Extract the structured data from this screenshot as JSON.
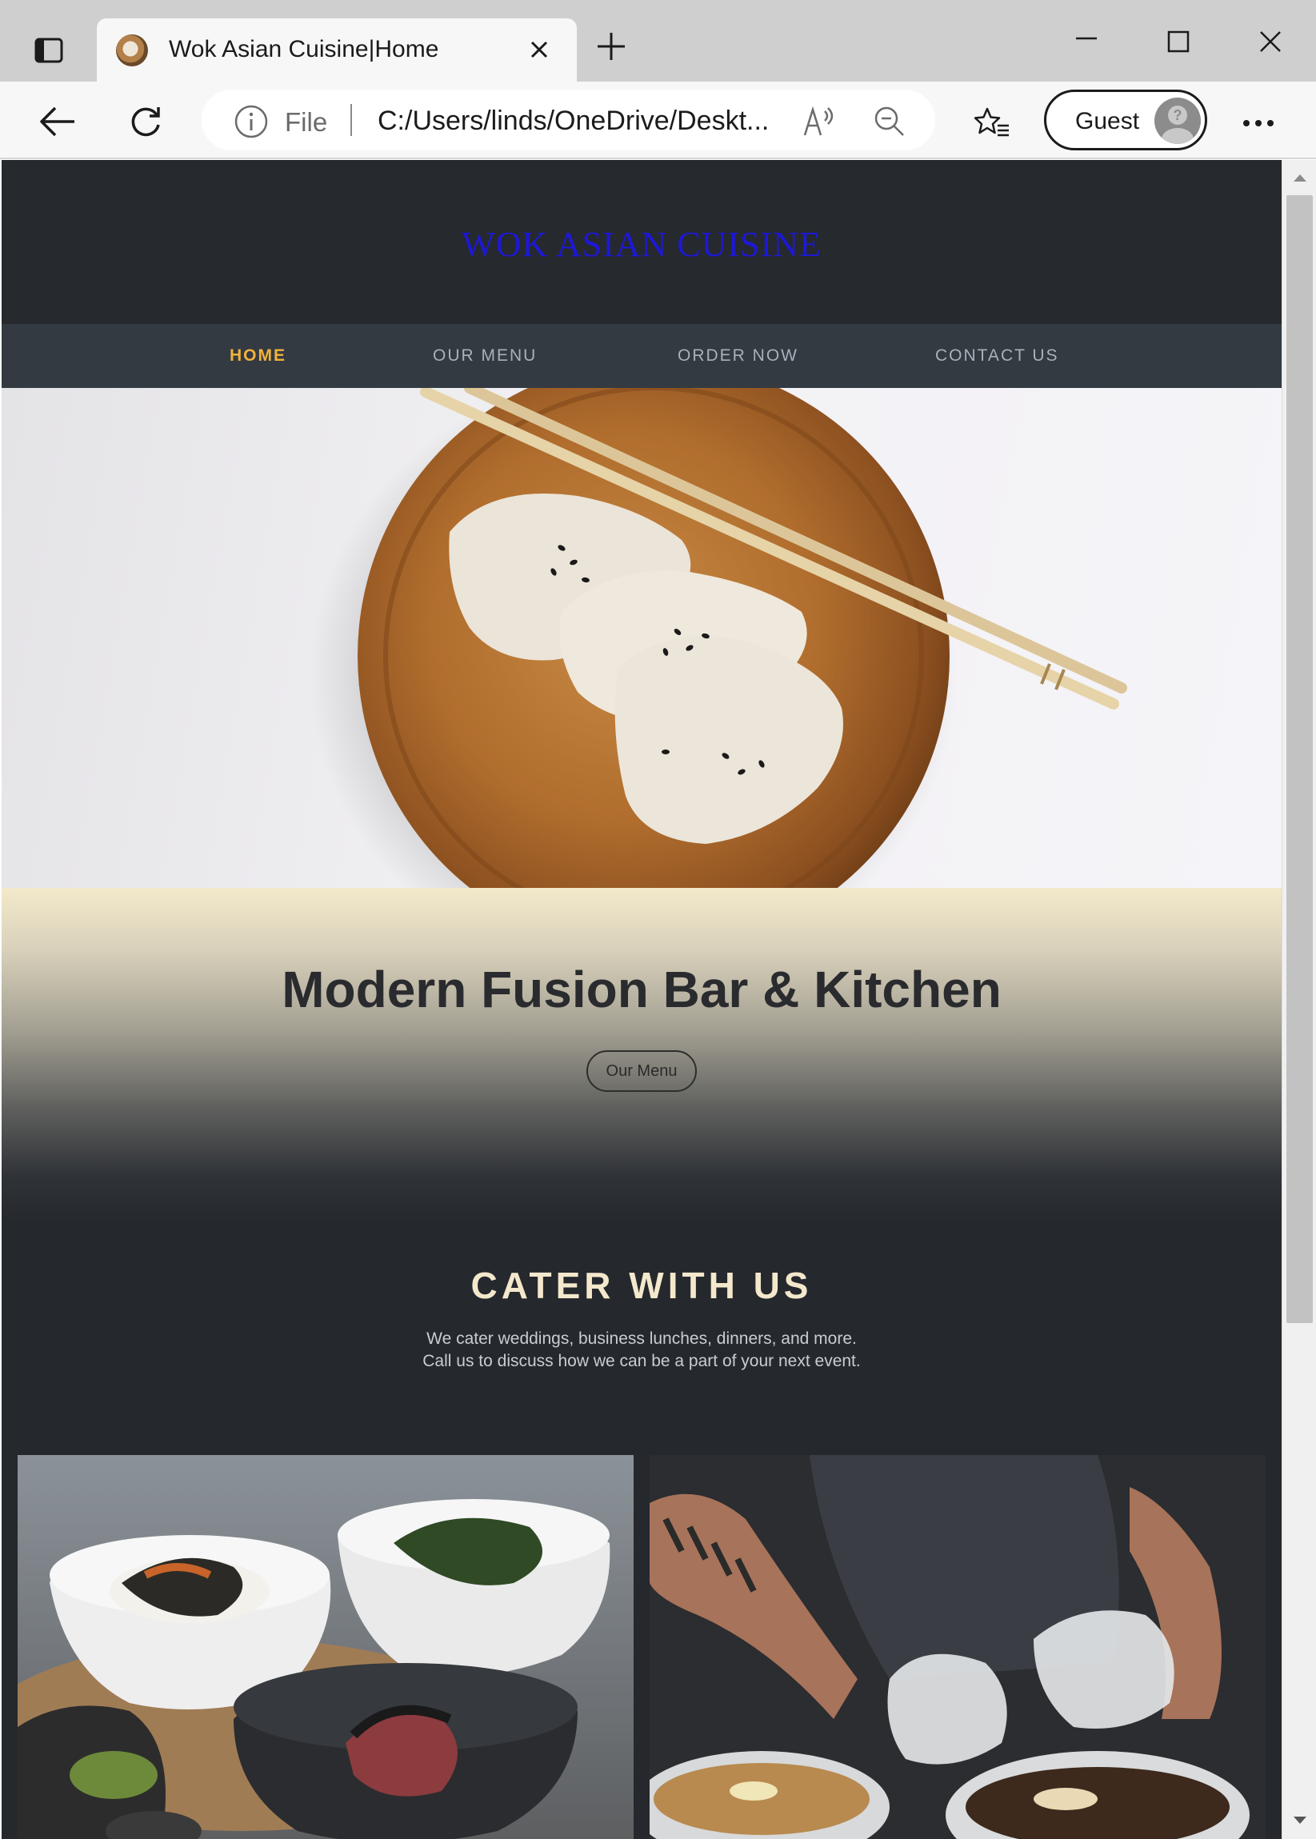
{
  "browser": {
    "tab": {
      "title": "Wok Asian Cuisine|Home",
      "favicon": "dumpling-plate-favicon"
    },
    "address": {
      "scheme": "File",
      "url": "C:/Users/linds/OneDrive/Deskt..."
    },
    "profile": {
      "label": "Guest"
    },
    "icons": {
      "tab_actions": "tab-actions-icon",
      "close_tab": "close-icon",
      "new_tab": "plus-icon",
      "minimize": "minimize-icon",
      "maximize": "maximize-icon",
      "close_window": "close-icon",
      "back": "back-arrow-icon",
      "reload": "reload-icon",
      "info": "info-icon",
      "read_aloud": "read-aloud-icon",
      "zoom": "zoom-out-icon",
      "favorites": "favorites-icon",
      "more": "more-icon"
    }
  },
  "site": {
    "logo": "WOK ASIAN CUISINE",
    "nav": [
      {
        "label": "HOME",
        "active": true
      },
      {
        "label": "OUR MENU",
        "active": false
      },
      {
        "label": "ORDER NOW",
        "active": false
      },
      {
        "label": "CONTACT US",
        "active": false
      }
    ],
    "banner": {
      "title": "Modern Fusion Bar & Kitchen",
      "button": "Our Menu"
    },
    "cater": {
      "title": "CATER WITH US",
      "line1": "We cater weddings, business lunches, dinners, and more.",
      "line2": "Call us to discuss how we can be a part of your next event."
    }
  },
  "colors": {
    "logo": "#1d18d6",
    "nav_active": "#f2b23c",
    "nav_inactive": "#a9b0b8",
    "page_dark": "#25282d",
    "nav_bg": "#333a42",
    "cater_title": "#f4e8cc"
  }
}
